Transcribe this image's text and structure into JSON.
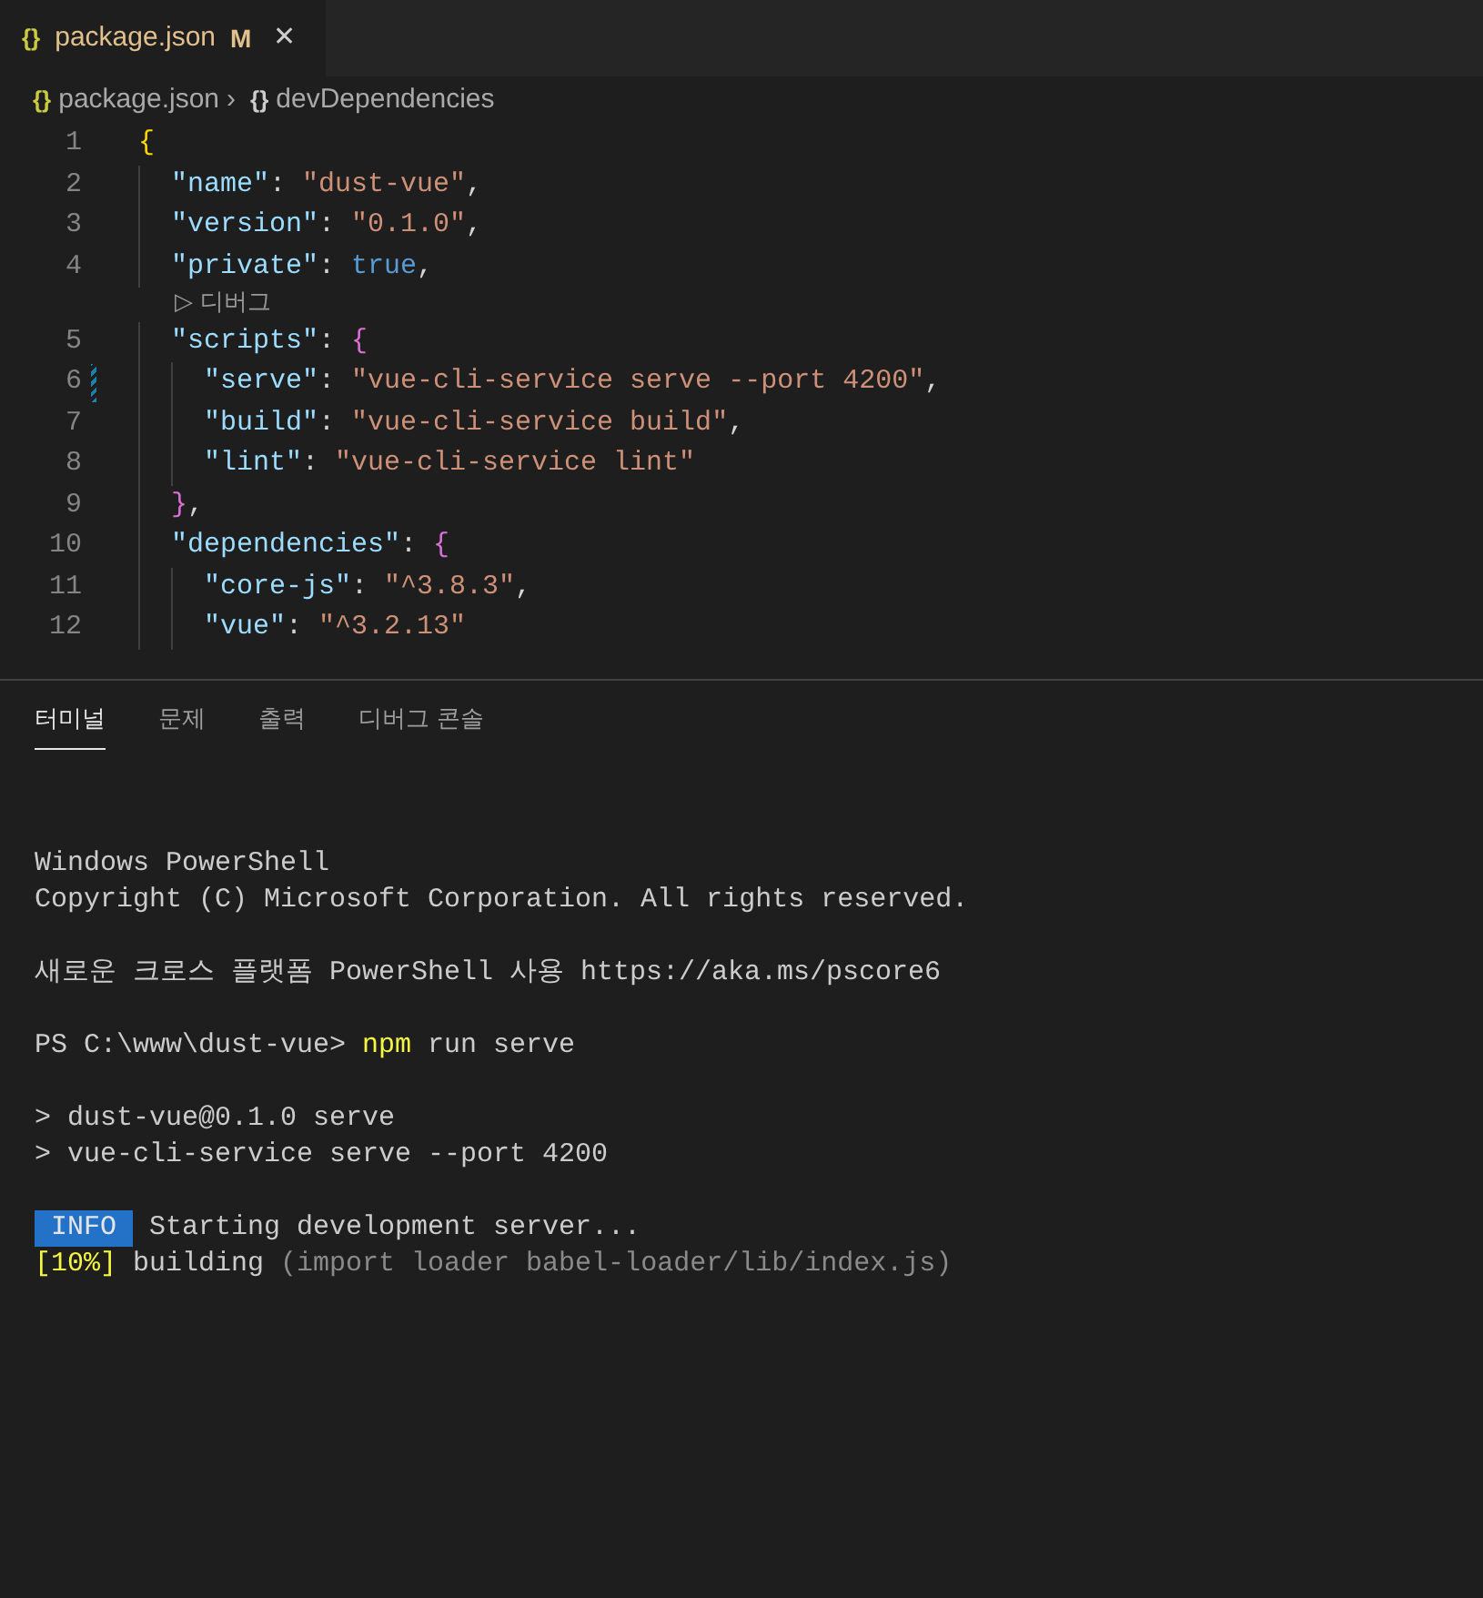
{
  "tab": {
    "icon": "{}",
    "label": "package.json",
    "badge": "M",
    "close": "✕",
    "selected": true
  },
  "breadcrumb": [
    {
      "icon": "{}",
      "label": "package.json",
      "kind": "file"
    },
    {
      "icon": "{}",
      "label": "devDependencies",
      "kind": "symbol"
    }
  ],
  "breadcrumb_separator": "›",
  "editor": {
    "lines": [
      {
        "number": "1",
        "modified": false,
        "tokens": [
          {
            "text": "{",
            "kind": "brace1"
          }
        ]
      },
      {
        "number": "2",
        "modified": false,
        "tokens": [
          {
            "text": "  \"name\"",
            "kind": "key"
          },
          {
            "text": ": ",
            "kind": "punct"
          },
          {
            "text": "\"dust-vue\"",
            "kind": "string"
          },
          {
            "text": ",",
            "kind": "punct"
          }
        ]
      },
      {
        "number": "3",
        "modified": false,
        "tokens": [
          {
            "text": "  \"version\"",
            "kind": "key"
          },
          {
            "text": ": ",
            "kind": "punct"
          },
          {
            "text": "\"0.1.0\"",
            "kind": "string"
          },
          {
            "text": ",",
            "kind": "punct"
          }
        ]
      },
      {
        "number": "4",
        "modified": false,
        "tokens": [
          {
            "text": "  \"private\"",
            "kind": "key"
          },
          {
            "text": ": ",
            "kind": "punct"
          },
          {
            "text": "true",
            "kind": "bool"
          },
          {
            "text": ",",
            "kind": "punct"
          }
        ],
        "codelens": {
          "icon": "▷",
          "label": "디버그"
        }
      },
      {
        "number": "5",
        "modified": false,
        "tokens": [
          {
            "text": "  \"scripts\"",
            "kind": "key"
          },
          {
            "text": ": ",
            "kind": "punct"
          },
          {
            "text": "{",
            "kind": "brace2"
          }
        ]
      },
      {
        "number": "6",
        "modified": true,
        "tokens": [
          {
            "text": "    \"serve\"",
            "kind": "key"
          },
          {
            "text": ": ",
            "kind": "punct"
          },
          {
            "text": "\"vue-cli-service serve --port 4200\"",
            "kind": "string"
          },
          {
            "text": ",",
            "kind": "punct"
          }
        ]
      },
      {
        "number": "7",
        "modified": false,
        "tokens": [
          {
            "text": "    \"build\"",
            "kind": "key"
          },
          {
            "text": ": ",
            "kind": "punct"
          },
          {
            "text": "\"vue-cli-service build\"",
            "kind": "string"
          },
          {
            "text": ",",
            "kind": "punct"
          }
        ]
      },
      {
        "number": "8",
        "modified": false,
        "tokens": [
          {
            "text": "    \"lint\"",
            "kind": "key"
          },
          {
            "text": ": ",
            "kind": "punct"
          },
          {
            "text": "\"vue-cli-service lint\"",
            "kind": "string"
          }
        ]
      },
      {
        "number": "9",
        "modified": false,
        "tokens": [
          {
            "text": "  }",
            "kind": "brace2"
          },
          {
            "text": ",",
            "kind": "punct"
          }
        ]
      },
      {
        "number": "10",
        "modified": false,
        "tokens": [
          {
            "text": "  \"dependencies\"",
            "kind": "key"
          },
          {
            "text": ": ",
            "kind": "punct"
          },
          {
            "text": "{",
            "kind": "brace2"
          }
        ]
      },
      {
        "number": "11",
        "modified": false,
        "tokens": [
          {
            "text": "    \"core-js\"",
            "kind": "key"
          },
          {
            "text": ": ",
            "kind": "punct"
          },
          {
            "text": "\"^3.8.3\"",
            "kind": "string"
          },
          {
            "text": ",",
            "kind": "punct"
          }
        ]
      },
      {
        "number": "12",
        "modified": false,
        "tokens": [
          {
            "text": "    \"vue\"",
            "kind": "key"
          },
          {
            "text": ": ",
            "kind": "punct"
          },
          {
            "text": "\"^3.2.13\"",
            "kind": "string"
          }
        ]
      }
    ]
  },
  "panel_tabs": [
    {
      "label": "터미널",
      "selected": true
    },
    {
      "label": "문제",
      "selected": false
    },
    {
      "label": "출력",
      "selected": false
    },
    {
      "label": "디버그 콘솔",
      "selected": false
    }
  ],
  "terminal": {
    "lines": [
      {
        "kind": "blank"
      },
      {
        "kind": "blank"
      },
      {
        "segments": [
          {
            "text": "Windows PowerShell",
            "kind": "plain"
          }
        ]
      },
      {
        "segments": [
          {
            "text": "Copyright (C) Microsoft Corporation. All rights reserved.",
            "kind": "plain"
          }
        ]
      },
      {
        "kind": "blank"
      },
      {
        "segments": [
          {
            "text": "새로운 크로스 플랫폼 PowerShell 사용 https://aka.ms/pscore6",
            "kind": "plain"
          }
        ]
      },
      {
        "kind": "blank"
      },
      {
        "segments": [
          {
            "text": "PS C:\\www\\dust-vue> ",
            "kind": "plain"
          },
          {
            "text": "npm",
            "kind": "yellow"
          },
          {
            "text": " run serve",
            "kind": "plain"
          }
        ]
      },
      {
        "kind": "blank"
      },
      {
        "segments": [
          {
            "text": "> dust-vue@0.1.0 serve",
            "kind": "plain"
          }
        ]
      },
      {
        "segments": [
          {
            "text": "> vue-cli-service serve --port 4200",
            "kind": "plain"
          }
        ]
      },
      {
        "kind": "blank"
      },
      {
        "segments": [
          {
            "text": " INFO ",
            "kind": "badge"
          },
          {
            "text": " Starting development server...",
            "kind": "plain"
          }
        ]
      },
      {
        "segments": [
          {
            "text": "[10%]",
            "kind": "yellow"
          },
          {
            "text": " building ",
            "kind": "plain"
          },
          {
            "text": "(import loader babel-loader/lib/index.js)",
            "kind": "dim"
          }
        ]
      }
    ]
  }
}
